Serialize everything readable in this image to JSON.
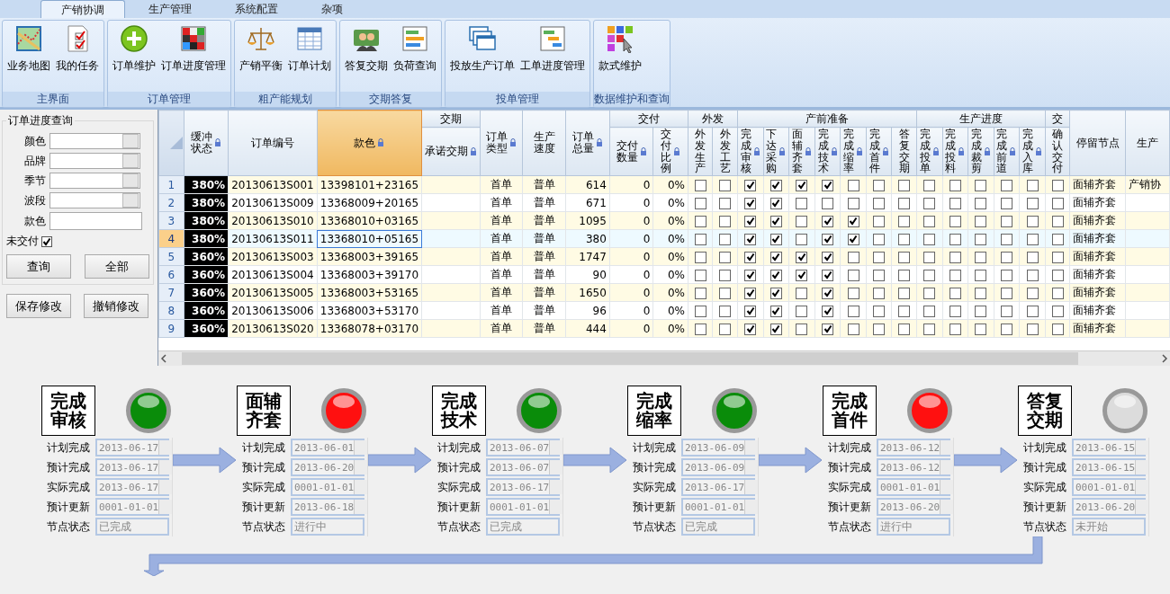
{
  "tabs": [
    {
      "label": "产销协调",
      "selected": true
    },
    {
      "label": "生产管理",
      "selected": false
    },
    {
      "label": "系统配置",
      "selected": false
    },
    {
      "label": "杂项",
      "selected": false
    }
  ],
  "ribbon": {
    "groups": [
      {
        "title": "主界面",
        "items": [
          {
            "label": "业务地图",
            "kind": "map"
          },
          {
            "label": "我的任务",
            "kind": "tasks"
          }
        ]
      },
      {
        "title": "订单管理",
        "items": [
          {
            "label": "订单维护",
            "kind": "add"
          },
          {
            "label": "订单进度管理",
            "kind": "grid"
          }
        ]
      },
      {
        "title": "粗产能规划",
        "items": [
          {
            "label": "产销平衡",
            "kind": "scale"
          },
          {
            "label": "订单计划",
            "kind": "table"
          }
        ]
      },
      {
        "title": "交期答复",
        "items": [
          {
            "label": "答复交期",
            "kind": "people"
          },
          {
            "label": "负荷查询",
            "kind": "bars"
          }
        ]
      },
      {
        "title": "投单管理",
        "items": [
          {
            "label": "投放生产订单",
            "kind": "windows"
          },
          {
            "label": "工单进度管理",
            "kind": "gantt"
          }
        ]
      },
      {
        "title": "数据维护和查询",
        "items": [
          {
            "label": "款式维护",
            "kind": "palette"
          }
        ]
      }
    ]
  },
  "query_panel": {
    "title": "订单进度查询",
    "fields": [
      {
        "label": "颜色",
        "kind": "select"
      },
      {
        "label": "品牌",
        "kind": "select"
      },
      {
        "label": "季节",
        "kind": "select"
      },
      {
        "label": "波段",
        "kind": "select"
      },
      {
        "label": "款色",
        "kind": "text"
      }
    ],
    "undelivered": {
      "label": "未交付",
      "checked": true
    },
    "buttons": [
      "查询",
      "全部"
    ]
  },
  "edit_buttons": [
    "保存修改",
    "撤销修改"
  ],
  "table": {
    "header": [
      {
        "label": "缓冲状态",
        "kind": "buffer",
        "locked": true,
        "selected": false
      },
      {
        "label": "订单编号",
        "kind": "text",
        "locked": false,
        "selected": false
      },
      {
        "label": "款色",
        "kind": "text",
        "locked": true,
        "selected": true
      },
      {
        "label": "交期",
        "kind": "group",
        "columns": [
          {
            "label": "承诺交期",
            "kind": "text",
            "locked": true,
            "selected": false
          }
        ]
      },
      {
        "label": "订单类型",
        "kind": "center",
        "locked": true,
        "selected": false
      },
      {
        "label": "生产速度",
        "kind": "center",
        "locked": false,
        "selected": false
      },
      {
        "label": "订单总量",
        "kind": "number",
        "locked": true,
        "selected": false
      },
      {
        "label": "交付",
        "kind": "group",
        "columns": [
          {
            "label": "交付数量",
            "kind": "number",
            "locked": true,
            "selected": false
          },
          {
            "label": "交付比例",
            "kind": "number",
            "locked": true,
            "selected": false
          }
        ]
      },
      {
        "label": "外发",
        "kind": "group",
        "columns": [
          {
            "label": "外发生产",
            "kind": "check",
            "locked": false,
            "selected": false
          },
          {
            "label": "外发工艺",
            "kind": "check",
            "locked": false,
            "selected": false
          }
        ]
      },
      {
        "label": "产前准备",
        "kind": "group",
        "columns": [
          {
            "label": "完成审核",
            "kind": "check",
            "locked": true,
            "selected": false
          },
          {
            "label": "下达采购",
            "kind": "check",
            "locked": true,
            "selected": false
          },
          {
            "label": "面辅齐套",
            "kind": "check",
            "locked": true,
            "selected": false
          },
          {
            "label": "完成技术",
            "kind": "check",
            "locked": true,
            "selected": false
          },
          {
            "label": "完成缩率",
            "kind": "check",
            "locked": true,
            "selected": false
          },
          {
            "label": "完成首件",
            "kind": "check",
            "locked": true,
            "selected": false
          },
          {
            "label": "答复交期",
            "kind": "check",
            "locked": false,
            "selected": false
          }
        ]
      },
      {
        "label": "生产进度",
        "kind": "group",
        "columns": [
          {
            "label": "完成投单",
            "kind": "check",
            "locked": true,
            "selected": false
          },
          {
            "label": "完成投料",
            "kind": "check",
            "locked": true,
            "selected": false
          },
          {
            "label": "完成裁剪",
            "kind": "check",
            "locked": true,
            "selected": false
          },
          {
            "label": "完成前道",
            "kind": "check",
            "locked": true,
            "selected": false
          },
          {
            "label": "完成入库",
            "kind": "check",
            "locked": true,
            "selected": false
          }
        ]
      },
      {
        "label": "交",
        "kind": "group",
        "columns": [
          {
            "label": "确认交付",
            "kind": "check",
            "locked": false,
            "selected": false
          }
        ]
      },
      {
        "label": "停留节点",
        "kind": "text",
        "locked": false,
        "selected": false
      },
      {
        "label": "生产",
        "kind": "text",
        "locked": false,
        "selected": false
      }
    ],
    "rows": [
      {
        "number": "1",
        "selected": false,
        "cells": [
          "380%",
          "20130613S001",
          "13398101+23165",
          null,
          "首单",
          "普单",
          "614",
          "0",
          "0%",
          false,
          false,
          true,
          true,
          true,
          true,
          false,
          false,
          false,
          false,
          false,
          false,
          false,
          false,
          false,
          "面辅齐套",
          "产销协"
        ]
      },
      {
        "number": "2",
        "selected": false,
        "cells": [
          "380%",
          "20130613S009",
          "13368009+20165",
          null,
          "首单",
          "普单",
          "671",
          "0",
          "0%",
          false,
          false,
          true,
          true,
          false,
          false,
          false,
          false,
          false,
          false,
          false,
          false,
          false,
          false,
          false,
          "面辅齐套",
          null
        ]
      },
      {
        "number": "3",
        "selected": false,
        "cells": [
          "380%",
          "20130613S010",
          "13368010+03165",
          null,
          "首单",
          "普单",
          "1095",
          "0",
          "0%",
          false,
          false,
          true,
          true,
          false,
          true,
          true,
          false,
          false,
          false,
          false,
          false,
          false,
          false,
          false,
          "面辅齐套",
          null
        ]
      },
      {
        "number": "4",
        "selected": true,
        "cells": [
          "380%",
          "20130613S011",
          "13368010+05165",
          null,
          "首单",
          "普单",
          "380",
          "0",
          "0%",
          false,
          false,
          true,
          true,
          false,
          true,
          true,
          false,
          false,
          false,
          false,
          false,
          false,
          false,
          false,
          "面辅齐套",
          null
        ]
      },
      {
        "number": "5",
        "selected": false,
        "cells": [
          "360%",
          "20130613S003",
          "13368003+39165",
          null,
          "首单",
          "普单",
          "1747",
          "0",
          "0%",
          false,
          false,
          true,
          true,
          true,
          true,
          false,
          false,
          false,
          false,
          false,
          false,
          false,
          false,
          false,
          "面辅齐套",
          null
        ]
      },
      {
        "number": "6",
        "selected": false,
        "cells": [
          "360%",
          "20130613S004",
          "13368003+39170",
          null,
          "首单",
          "普单",
          "90",
          "0",
          "0%",
          false,
          false,
          true,
          true,
          true,
          true,
          false,
          false,
          false,
          false,
          false,
          false,
          false,
          false,
          false,
          "面辅齐套",
          null
        ]
      },
      {
        "number": "7",
        "selected": false,
        "cells": [
          "360%",
          "20130613S005",
          "13368003+53165",
          null,
          "首单",
          "普单",
          "1650",
          "0",
          "0%",
          false,
          false,
          true,
          true,
          false,
          true,
          false,
          false,
          false,
          false,
          false,
          false,
          false,
          false,
          false,
          "面辅齐套",
          null
        ]
      },
      {
        "number": "8",
        "selected": false,
        "cells": [
          "360%",
          "20130613S006",
          "13368003+53170",
          null,
          "首单",
          "普单",
          "96",
          "0",
          "0%",
          false,
          false,
          true,
          true,
          false,
          true,
          false,
          false,
          false,
          false,
          false,
          false,
          false,
          false,
          false,
          "面辅齐套",
          null
        ]
      },
      {
        "number": "9",
        "selected": false,
        "cells": [
          "360%",
          "20130613S020",
          "13368078+03170",
          null,
          "首单",
          "普单",
          "444",
          "0",
          "0%",
          false,
          false,
          true,
          true,
          false,
          true,
          false,
          false,
          false,
          false,
          false,
          false,
          false,
          false,
          false,
          "面辅齐套",
          null
        ]
      }
    ]
  },
  "flow": {
    "nodes": [
      {
        "title": "完成审核",
        "color": "#0a8c0a",
        "fields": [
          {
            "label": "计划完成",
            "value": "2013-06-17",
            "kind": "date"
          },
          {
            "label": "预计完成",
            "value": "2013-06-17",
            "kind": "date"
          },
          {
            "label": "实际完成",
            "value": "2013-06-17",
            "kind": "date"
          },
          {
            "label": "预计更新",
            "value": "0001-01-01",
            "kind": "date"
          },
          {
            "label": "节点状态",
            "value": "已完成",
            "kind": "text"
          }
        ]
      },
      {
        "title": "面辅齐套",
        "color": "#ff1010",
        "fields": [
          {
            "label": "计划完成",
            "value": "2013-06-01",
            "kind": "date"
          },
          {
            "label": "预计完成",
            "value": "2013-06-20",
            "kind": "date"
          },
          {
            "label": "实际完成",
            "value": "0001-01-01",
            "kind": "date"
          },
          {
            "label": "预计更新",
            "value": "2013-06-18",
            "kind": "date"
          },
          {
            "label": "节点状态",
            "value": "进行中",
            "kind": "text"
          }
        ]
      },
      {
        "title": "完成技术",
        "color": "#0a8c0a",
        "fields": [
          {
            "label": "计划完成",
            "value": "2013-06-07",
            "kind": "date"
          },
          {
            "label": "预计完成",
            "value": "2013-06-07",
            "kind": "date"
          },
          {
            "label": "实际完成",
            "value": "2013-06-17",
            "kind": "date"
          },
          {
            "label": "预计更新",
            "value": "0001-01-01",
            "kind": "date"
          },
          {
            "label": "节点状态",
            "value": "已完成",
            "kind": "text"
          }
        ]
      },
      {
        "title": "完成缩率",
        "color": "#0a8c0a",
        "fields": [
          {
            "label": "计划完成",
            "value": "2013-06-09",
            "kind": "date"
          },
          {
            "label": "预计完成",
            "value": "2013-06-09",
            "kind": "date"
          },
          {
            "label": "实际完成",
            "value": "2013-06-17",
            "kind": "date"
          },
          {
            "label": "预计更新",
            "value": "0001-01-01",
            "kind": "date"
          },
          {
            "label": "节点状态",
            "value": "已完成",
            "kind": "text"
          }
        ]
      },
      {
        "title": "完成首件",
        "color": "#ff1010",
        "fields": [
          {
            "label": "计划完成",
            "value": "2013-06-12",
            "kind": "date"
          },
          {
            "label": "预计完成",
            "value": "2013-06-12",
            "kind": "date"
          },
          {
            "label": "实际完成",
            "value": "0001-01-01",
            "kind": "date"
          },
          {
            "label": "预计更新",
            "value": "2013-06-20",
            "kind": "date"
          },
          {
            "label": "节点状态",
            "value": "进行中",
            "kind": "text"
          }
        ]
      },
      {
        "title": "答复交期",
        "color": "#dcdcdc",
        "fields": [
          {
            "label": "计划完成",
            "value": "2013-06-15",
            "kind": "date"
          },
          {
            "label": "预计完成",
            "value": "2013-06-15",
            "kind": "date"
          },
          {
            "label": "实际完成",
            "value": "0001-01-01",
            "kind": "date"
          },
          {
            "label": "预计更新",
            "value": "2013-06-20",
            "kind": "date"
          },
          {
            "label": "节点状态",
            "value": "未开始",
            "kind": "text"
          }
        ]
      }
    ]
  }
}
